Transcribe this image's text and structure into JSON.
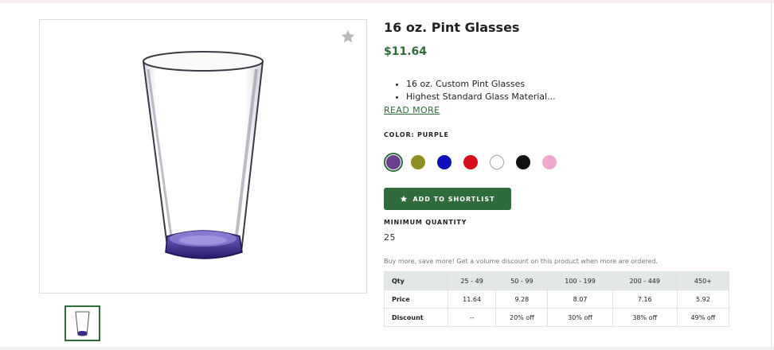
{
  "product": {
    "title": "16 oz. Pint Glasses",
    "price": "$11.64",
    "features": [
      "16 oz. Custom Pint Glasses",
      "Highest Standard Glass Material..."
    ],
    "read_more": "READ MORE",
    "color_label": "COLOR:",
    "color_value": "PURPLE",
    "swatches": [
      {
        "name": "purple",
        "color": "#6b3f8f"
      },
      {
        "name": "olive",
        "color": "#8f8f22"
      },
      {
        "name": "blue",
        "color": "#1010b8"
      },
      {
        "name": "red",
        "color": "#d4101c"
      },
      {
        "name": "white",
        "color": "#ffffff"
      },
      {
        "name": "black",
        "color": "#111111"
      },
      {
        "name": "pink",
        "color": "#f0a8cf"
      }
    ],
    "shortlist_label": "ADD TO SHORTLIST",
    "min_qty_label": "MINIMUM QUANTITY",
    "min_qty_value": "25",
    "promo_text": "Buy more, save more! Get a volume discount on this product when more are ordered."
  },
  "pricing_table": {
    "header": [
      "Qty",
      "25 - 49",
      "50 - 99",
      "100 - 199",
      "200 - 449",
      "450+"
    ],
    "price": [
      "Price",
      "11.64",
      "9.28",
      "8.07",
      "7.16",
      "5.92"
    ],
    "discount": [
      "Discount",
      "--",
      "20% off",
      "30% off",
      "38% off",
      "49% off"
    ]
  },
  "colors": {
    "accent": "#2f6b3b",
    "table_header_bg": "#e3e8e5"
  },
  "icons": {
    "favorite": "star-icon",
    "shortlist": "star-icon"
  }
}
